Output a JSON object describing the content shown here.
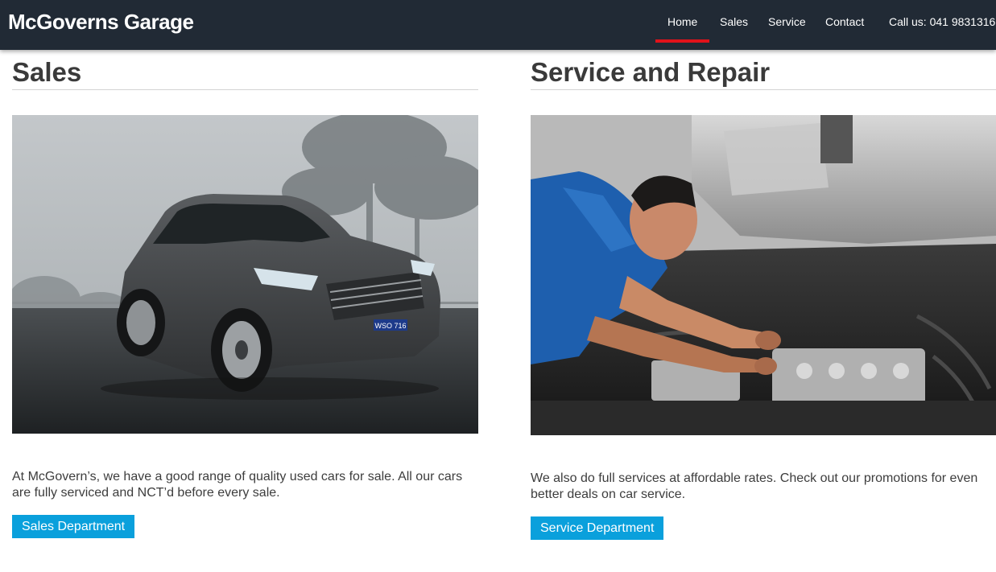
{
  "brand": "McGoverns Garage",
  "nav": {
    "home": "Home",
    "sales": "Sales",
    "service": "Service",
    "contact": "Contact",
    "call": "Call us: 041 9831316"
  },
  "sales": {
    "title": "Sales",
    "description": "At McGovern’s, we have a good range of quality used cars for sale. All our cars are fully serviced and NCT’d before every sale.",
    "button": "Sales Department",
    "photo_plate": "WSO 716"
  },
  "service": {
    "title": "Service and Repair",
    "description": "We also do full services at affordable rates. Check out our promotions for even better deals on car service.",
    "button": "Service Department"
  },
  "colors": {
    "navbar": "#212a35",
    "active_underline": "#e0121a",
    "button": "#0aa0dc"
  }
}
